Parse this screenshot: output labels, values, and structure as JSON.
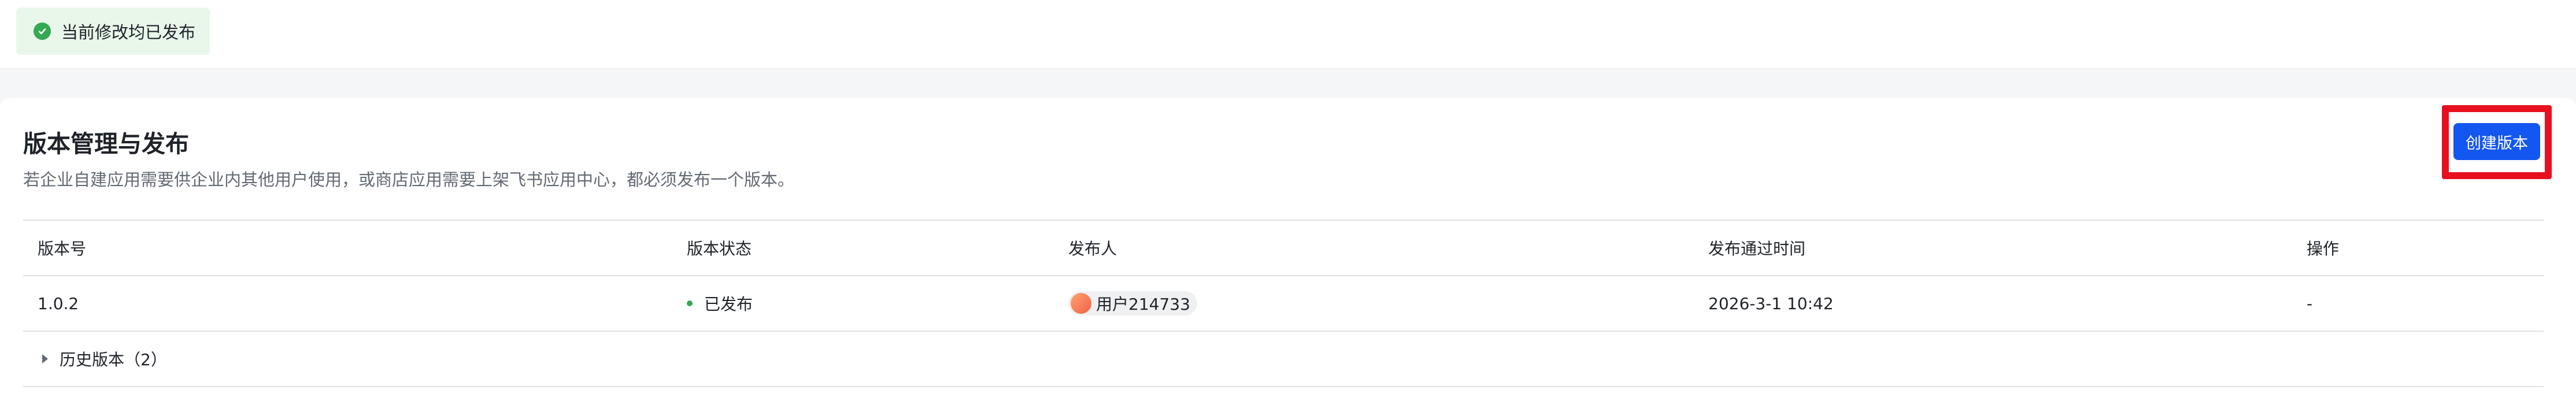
{
  "status": {
    "text": "当前修改均已发布",
    "icon": "check-circle-icon",
    "color": "#34a853"
  },
  "section": {
    "title": "版本管理与发布",
    "description": "若企业自建应用需要供企业内其他用户使用，或商店应用需要上架飞书应用中心，都必须发布一个版本。",
    "create_button_label": "创建版本"
  },
  "table": {
    "columns": [
      "版本号",
      "版本状态",
      "发布人",
      "发布通过时间",
      "操作"
    ],
    "rows": [
      {
        "version": "1.0.2",
        "status": "已发布",
        "publisher": "用户214733",
        "published_at": "2026-3-1 10:42",
        "action": "-"
      }
    ],
    "history_label": "历史版本（2）"
  },
  "colors": {
    "accent": "#1456f0",
    "highlight": "#e8101e",
    "published": "#34a853"
  }
}
